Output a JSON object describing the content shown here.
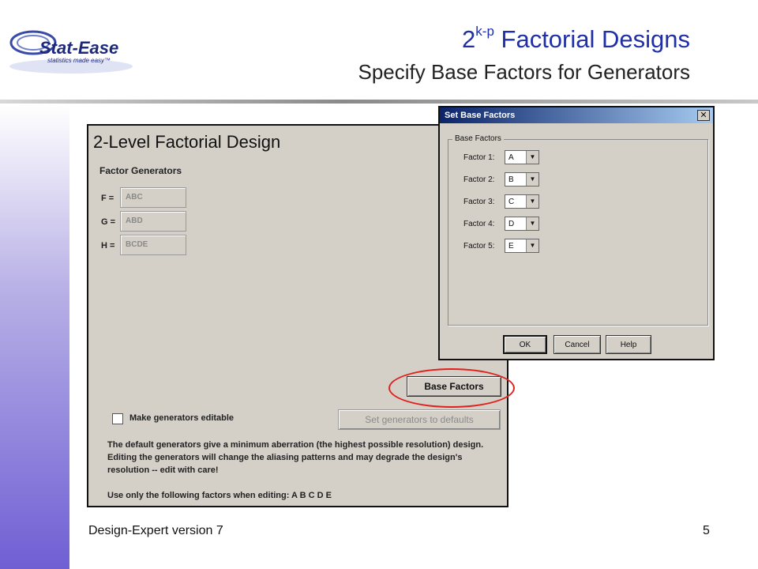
{
  "slide": {
    "title_base": "2",
    "title_sup": "k-p",
    "title_rest": " Factorial Designs",
    "subtitle": "Specify Base Factors for Generators",
    "footer_left": "Design-Expert version 7",
    "page_number": "5"
  },
  "logo": {
    "name": "Stat-Ease",
    "tagline": "statistics made easy™"
  },
  "main_window": {
    "title": "2-Level Factorial Design",
    "generators_label": "Factor Generators",
    "generators": [
      {
        "label": "F =",
        "value": "ABC"
      },
      {
        "label": "G =",
        "value": "ABD"
      },
      {
        "label": "H =",
        "value": "BCDE"
      }
    ],
    "base_factors_button": "Base Factors",
    "editable_checkbox_label": "Make generators editable",
    "defaults_button": "Set generators to defaults",
    "note_lines": [
      "The default generators give a minimum aberration (the highest possible resolution) design.",
      "Editing the generators will change the aliasing patterns and may degrade the design's",
      "resolution  -- edit with care!"
    ],
    "factors_note": "Use only the following factors when editing: A B C D E"
  },
  "dialog": {
    "title": "Set Base Factors",
    "close_symbol": "✕",
    "group_label": "Base Factors",
    "factors": [
      {
        "label": "Factor 1:",
        "value": "A"
      },
      {
        "label": "Factor 2:",
        "value": "B"
      },
      {
        "label": "Factor 3:",
        "value": "C"
      },
      {
        "label": "Factor 4:",
        "value": "D"
      },
      {
        "label": "Factor 5:",
        "value": "E"
      }
    ],
    "ok": "OK",
    "cancel": "Cancel",
    "help": "Help"
  },
  "colors": {
    "title_blue": "#1f2fa8",
    "highlight_red": "#e0201c",
    "dialog_gray": "#d4d0c8",
    "titlebar_blue": "#0a246a"
  }
}
